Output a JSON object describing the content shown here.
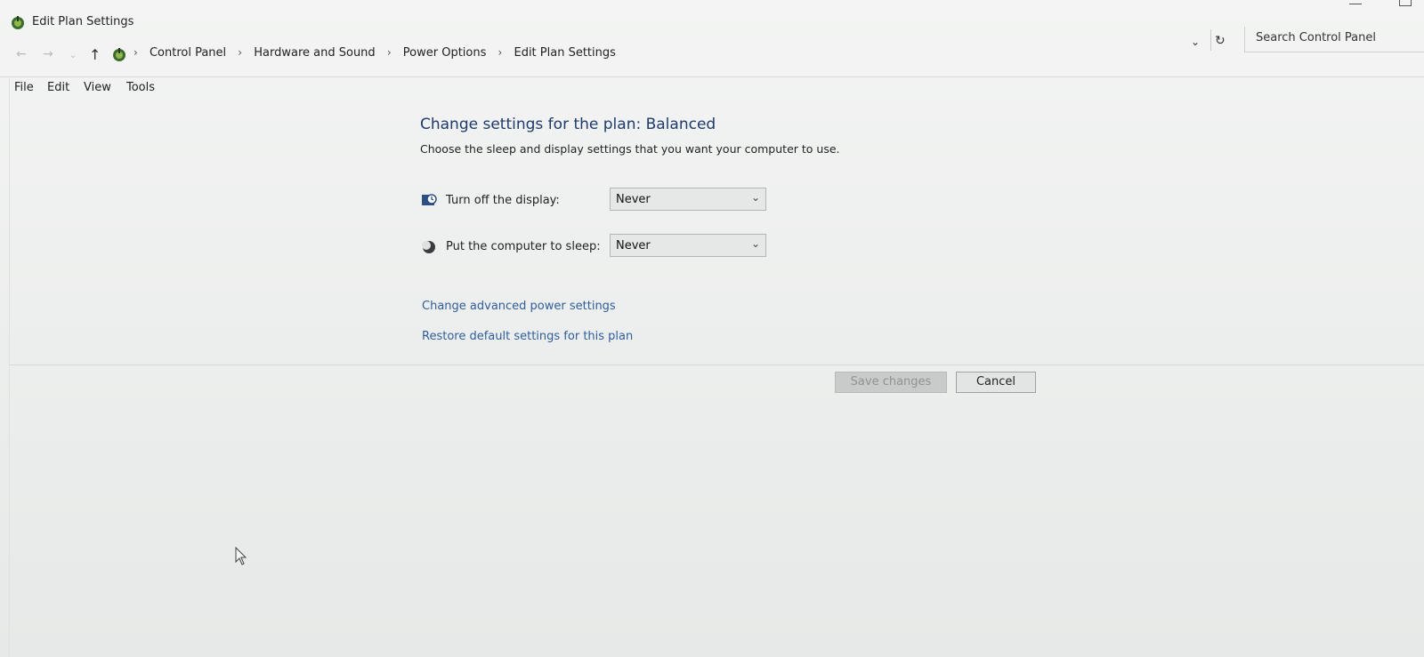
{
  "window": {
    "title": "Edit Plan Settings"
  },
  "address": {
    "crumbs": [
      "Control Panel",
      "Hardware and Sound",
      "Power Options",
      "Edit Plan Settings"
    ],
    "search_placeholder": "Search Control Panel"
  },
  "menu": {
    "items": [
      "File",
      "Edit",
      "View",
      "Tools"
    ]
  },
  "main": {
    "heading": "Change settings for the plan: Balanced",
    "subheading": "Choose the sleep and display settings that you want your computer to use.",
    "display_label": "Turn off the display:",
    "display_value": "Never",
    "sleep_label": "Put the computer to sleep:",
    "sleep_value": "Never",
    "link_advanced": "Change advanced power settings",
    "link_restore": "Restore default settings for this plan",
    "save_label": "Save changes",
    "cancel_label": "Cancel"
  },
  "icons": {
    "title": "power-options-icon",
    "address": "power-options-icon",
    "display": "monitor-icon",
    "sleep": "moon-icon"
  },
  "colors": {
    "heading": "#1e3a6b",
    "link": "#2f5d9a"
  }
}
